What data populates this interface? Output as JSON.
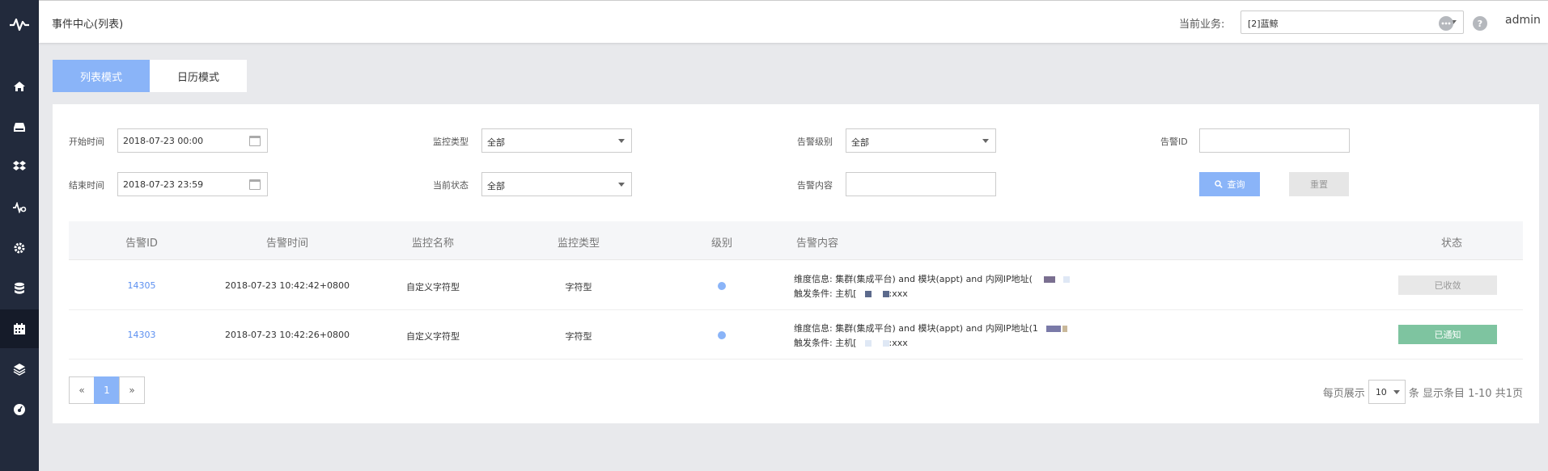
{
  "header": {
    "title": "事件中心(列表)",
    "business_label": "当前业务:",
    "business_value": "[2]蓝鲸",
    "more_icon": "ellipsis-icon",
    "help_icon": "help-icon",
    "help_glyph": "?",
    "user": "admin"
  },
  "sidebar": {
    "logo": "pulse-logo-icon",
    "items": [
      {
        "icon": "home-icon"
      },
      {
        "icon": "server-icon"
      },
      {
        "icon": "dropbox-icon"
      },
      {
        "icon": "monitor-icon"
      },
      {
        "icon": "settings-icon"
      },
      {
        "icon": "database-icon"
      },
      {
        "icon": "calendar-icon",
        "active": true
      },
      {
        "icon": "layers-icon"
      },
      {
        "icon": "dashboard-icon"
      }
    ]
  },
  "tabs": {
    "list": "列表模式",
    "calendar": "日历模式"
  },
  "filters": {
    "start_label": "开始时间",
    "start_value": "2018-07-23 00:00",
    "end_label": "结束时间",
    "end_value": "2018-07-23 23:59",
    "monitor_type_label": "监控类型",
    "monitor_type_value": "全部",
    "status_label": "当前状态",
    "status_value": "全部",
    "level_label": "告警级别",
    "level_value": "全部",
    "content_label": "告警内容",
    "content_value": "",
    "alarm_id_label": "告警ID",
    "alarm_id_value": "",
    "query_btn": "查询",
    "reset_btn": "重置"
  },
  "table": {
    "headers": [
      "告警ID",
      "告警时间",
      "监控名称",
      "监控类型",
      "级别",
      "告警内容",
      "状态"
    ],
    "rows": [
      {
        "id": "14305",
        "time": "2018-07-23 10:42:42+0800",
        "name": "自定义字符型",
        "type": "字符型",
        "content_line1": "维度信息: 集群(集成平台) and 模块(appt) and 内网IP地址(",
        "content_line2": "触发条件: 主机[",
        "content_tail": ":xxx",
        "status": "已收敛"
      },
      {
        "id": "14303",
        "time": "2018-07-23 10:42:26+0800",
        "name": "自定义字符型",
        "type": "字符型",
        "content_line1": "维度信息: 集群(集成平台) and 模块(appt) and 内网IP地址(1",
        "content_line2": "触发条件: 主机[",
        "content_tail": ":xxx",
        "status": "已通知"
      }
    ]
  },
  "pagination": {
    "prev": "«",
    "current": "1",
    "next": "»",
    "per_page_label": "每页展示",
    "per_page_value": "10",
    "summary": "条 显示条目 1-10 共1页"
  },
  "colors": {
    "accent": "#8ab4f8",
    "sidebar": "#222a3c",
    "notified": "#7ec4a0"
  }
}
